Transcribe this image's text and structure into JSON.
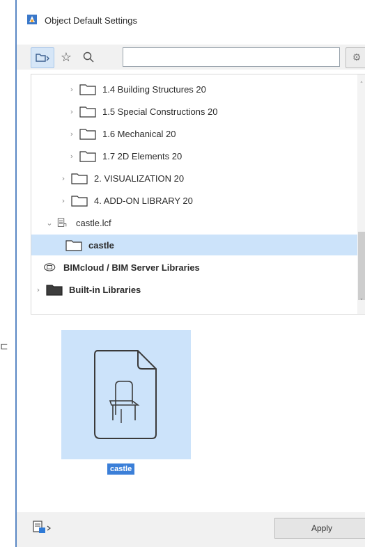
{
  "window": {
    "title": "Object Default Settings"
  },
  "toolbar": {
    "search_placeholder": "",
    "search_value": ""
  },
  "tree": {
    "items": [
      {
        "label": "1.4 Building Structures 20",
        "expanded": false,
        "icon": "folder-icon"
      },
      {
        "label": "1.5 Special Constructions 20",
        "expanded": false,
        "icon": "folder-icon"
      },
      {
        "label": "1.6 Mechanical 20",
        "expanded": false,
        "icon": "folder-icon"
      },
      {
        "label": "1.7 2D Elements 20",
        "expanded": false,
        "icon": "folder-icon"
      },
      {
        "label": "2. VISUALIZATION 20",
        "expanded": false,
        "icon": "folder-icon"
      },
      {
        "label": "4. ADD-ON LIBRARY 20",
        "expanded": false,
        "icon": "folder-icon"
      },
      {
        "label": "castle.lcf",
        "expanded": true,
        "icon": "library-container-icon"
      },
      {
        "label": "castle",
        "selected": true,
        "icon": "folder-icon"
      },
      {
        "label": "BIMcloud / BIM Server Libraries",
        "icon": "bimcloud-icon"
      },
      {
        "label": "Built-in Libraries",
        "expanded": false,
        "icon": "dark-folder-icon"
      }
    ]
  },
  "preview": {
    "caption": "castle",
    "icon": "chair-object-file-icon"
  },
  "footer": {
    "apply_label": "Apply"
  },
  "colors": {
    "selection": "#cce3fa",
    "caption_highlight": "#3b7fd8",
    "window_border": "#5a87c4"
  }
}
